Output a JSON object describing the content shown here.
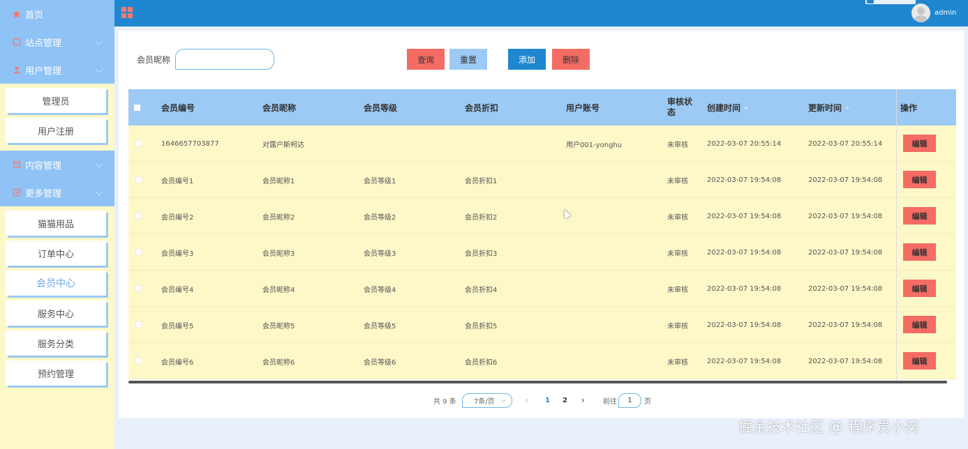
{
  "sidebar": {
    "home": "首页",
    "groups": [
      {
        "label": "站点管理"
      },
      {
        "label": "用户管理",
        "items": [
          "管理员",
          "用户注册"
        ]
      },
      {
        "label": "内容管理"
      },
      {
        "label": "更多管理",
        "items": [
          "猫猫用品",
          "订单中心",
          "会员中心",
          "服务中心",
          "服务分类",
          "预约管理"
        ]
      }
    ],
    "active_item": "会员中心"
  },
  "header": {
    "username": "admin"
  },
  "search": {
    "label": "会员昵称",
    "value": ""
  },
  "toolbar": {
    "query": "查询",
    "reset": "重置",
    "add": "添加",
    "delete": "删除"
  },
  "table": {
    "columns": [
      "会员编号",
      "会员昵称",
      "会员等级",
      "会员折扣",
      "用户账号",
      "审核状态",
      "创建时间",
      "更新时间",
      "操作"
    ],
    "rows": [
      {
        "id": "1646657703877",
        "nickname": "对露户斯柯达",
        "level": "",
        "discount": "",
        "account": "用户001-yonghu",
        "status": "未审核",
        "created": "2022-03-07 20:55:14",
        "updated": "2022-03-07 20:55:14"
      },
      {
        "id": "会员编号1",
        "nickname": "会员昵称1",
        "level": "会员等级1",
        "discount": "会员折扣1",
        "account": "",
        "status": "未审核",
        "created": "2022-03-07 19:54:08",
        "updated": "2022-03-07 19:54:08"
      },
      {
        "id": "会员编号2",
        "nickname": "会员昵称2",
        "level": "会员等级2",
        "discount": "会员折扣2",
        "account": "",
        "status": "未审核",
        "created": "2022-03-07 19:54:08",
        "updated": "2022-03-07 19:54:08"
      },
      {
        "id": "会员编号3",
        "nickname": "会员昵称3",
        "level": "会员等级3",
        "discount": "会员折扣3",
        "account": "",
        "status": "未审核",
        "created": "2022-03-07 19:54:08",
        "updated": "2022-03-07 19:54:08"
      },
      {
        "id": "会员编号4",
        "nickname": "会员昵称4",
        "level": "会员等级4",
        "discount": "会员折扣4",
        "account": "",
        "status": "未审核",
        "created": "2022-03-07 19:54:08",
        "updated": "2022-03-07 19:54:08"
      },
      {
        "id": "会员编号5",
        "nickname": "会员昵称5",
        "level": "会员等级5",
        "discount": "会员折扣5",
        "account": "",
        "status": "未审核",
        "created": "2022-03-07 19:54:08",
        "updated": "2022-03-07 19:54:08"
      },
      {
        "id": "会员编号6",
        "nickname": "会员昵称6",
        "level": "会员等级6",
        "discount": "会员折扣6",
        "account": "",
        "status": "未审核",
        "created": "2022-03-07 19:54:08",
        "updated": "2022-03-07 19:54:08"
      }
    ],
    "edit_label": "编辑"
  },
  "pagination": {
    "total": "共 9 条",
    "page_size": "7条/页",
    "pages": [
      "1",
      "2"
    ],
    "current": "1",
    "goto_prefix": "前往",
    "goto_value": "1",
    "goto_suffix": "页"
  },
  "watermark": "掘金技术社区 @ 程序员小奕",
  "colors": {
    "header": "#1f86d0",
    "sidebar_nav": "#8fc2f5",
    "row_bg": "#fdf8c8",
    "table_head": "#9ccaf5",
    "danger": "#f46c64"
  }
}
